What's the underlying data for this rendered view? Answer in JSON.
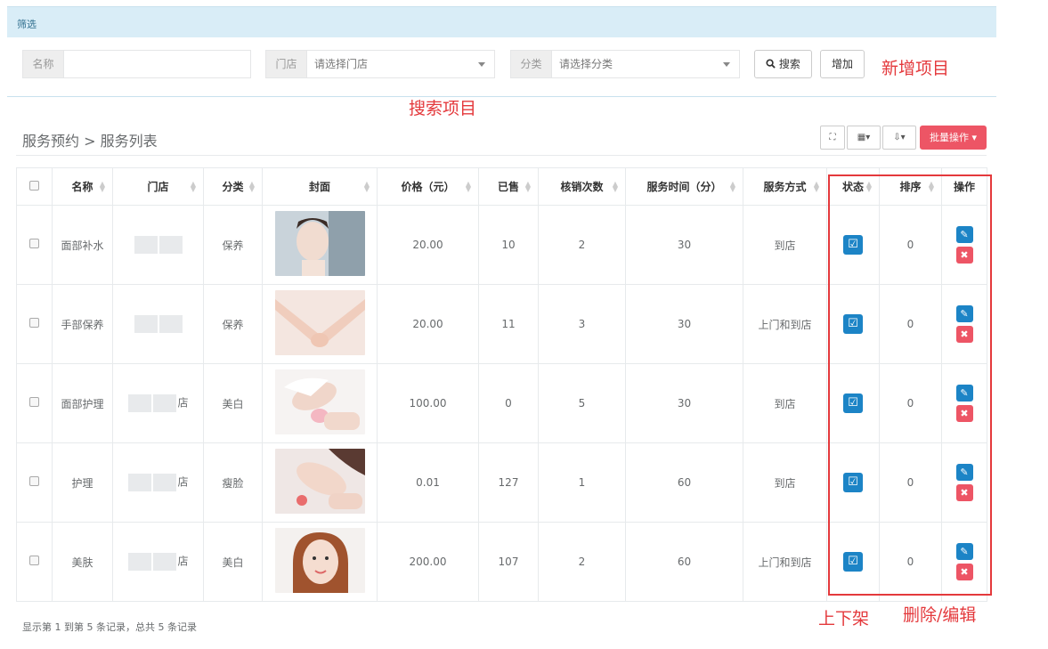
{
  "filter_title": "筛选",
  "search": {
    "name_label": "名称",
    "name_value": "",
    "store_label": "门店",
    "store_placeholder": "请选择门店",
    "category_label": "分类",
    "category_placeholder": "请选择分类",
    "search_label": "搜索",
    "add_label": "增加"
  },
  "annotations": {
    "add": "新增项目",
    "search": "搜索项目",
    "status": "上下架",
    "ops": "删除/编辑"
  },
  "page_title": "服务预约 > 服务列表",
  "toolbar": {
    "batch_label": "批量操作 ▾"
  },
  "table": {
    "headers": [
      "名称",
      "门店",
      "分类",
      "封面",
      "价格（元）",
      "已售",
      "核销次数",
      "服务时间（分）",
      "服务方式",
      "状态",
      "排序",
      "操作"
    ],
    "rows": [
      {
        "name": "面部补水",
        "store": "",
        "category": "保养",
        "price": "20.00",
        "sold": "10",
        "verify": "2",
        "duration": "30",
        "method": "到店",
        "sort": "0"
      },
      {
        "name": "手部保养",
        "store": "",
        "category": "保养",
        "price": "20.00",
        "sold": "11",
        "verify": "3",
        "duration": "30",
        "method": "上门和到店",
        "sort": "0"
      },
      {
        "name": "面部护理",
        "store": "店",
        "category": "美白",
        "price": "100.00",
        "sold": "0",
        "verify": "5",
        "duration": "30",
        "method": "到店",
        "sort": "0"
      },
      {
        "name": "护理",
        "store": "店",
        "category": "瘦脸",
        "price": "0.01",
        "sold": "127",
        "verify": "1",
        "duration": "60",
        "method": "到店",
        "sort": "0"
      },
      {
        "name": "美肤",
        "store": "店",
        "category": "美白",
        "price": "200.00",
        "sold": "107",
        "verify": "2",
        "duration": "60",
        "method": "上门和到店",
        "sort": "0"
      }
    ]
  },
  "footer": "显示第 1 到第 5 条记录，总共 5 条记录",
  "colors": {
    "primary": "#1c84c6",
    "danger": "#ed5565",
    "annotation": "#e4393c",
    "filter_bg": "#d9edf7"
  }
}
